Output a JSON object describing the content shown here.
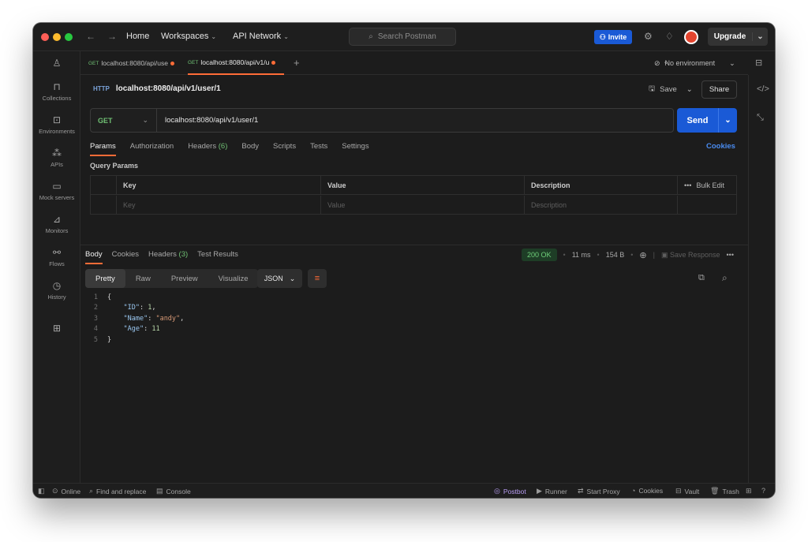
{
  "topbar": {
    "home": "Home",
    "workspaces": "Workspaces",
    "api_network": "API Network",
    "search_placeholder": "Search Postman",
    "invite": "Invite",
    "upgrade": "Upgrade"
  },
  "sidebar": {
    "items": [
      {
        "label": "Collections",
        "icon": "collections-icon"
      },
      {
        "label": "Environments",
        "icon": "environments-icon"
      },
      {
        "label": "APIs",
        "icon": "apis-icon"
      },
      {
        "label": "Mock servers",
        "icon": "mock-servers-icon"
      },
      {
        "label": "Monitors",
        "icon": "monitors-icon"
      },
      {
        "label": "Flows",
        "icon": "flows-icon"
      },
      {
        "label": "History",
        "icon": "history-icon"
      }
    ]
  },
  "tabs": [
    {
      "method": "GET",
      "label": "localhost:8080/api/use"
    },
    {
      "method": "GET",
      "label": "localhost:8080/api/v1/u"
    }
  ],
  "environment": "No environment",
  "request": {
    "title": "localhost:8080/api/v1/user/1",
    "http_badge": "HTTP",
    "save": "Save",
    "share": "Share",
    "method": "GET",
    "url": "localhost:8080/api/v1/user/1",
    "send": "Send",
    "tabs": {
      "params": "Params",
      "authorization": "Authorization",
      "headers": "Headers",
      "headers_count": "(6)",
      "body": "Body",
      "scripts": "Scripts",
      "tests": "Tests",
      "settings": "Settings"
    },
    "cookies": "Cookies",
    "query_params_title": "Query Params",
    "params_table": {
      "headers": [
        "Key",
        "Value",
        "Description"
      ],
      "bulk_edit": "Bulk Edit",
      "placeholders": [
        "Key",
        "Value",
        "Description"
      ]
    }
  },
  "response": {
    "tabs": {
      "body": "Body",
      "cookies": "Cookies",
      "headers": "Headers",
      "headers_count": "(3)",
      "test_results": "Test Results"
    },
    "status": "200 OK",
    "time": "11 ms",
    "size": "154 B",
    "save_response": "Save Response",
    "format_tabs": [
      "Pretty",
      "Raw",
      "Preview",
      "Visualize"
    ],
    "format": "JSON",
    "lines": [
      {
        "n": "1",
        "text": "{"
      },
      {
        "n": "2",
        "key": "\"ID\"",
        "value": "1",
        "value_type": "number",
        "trail": ","
      },
      {
        "n": "3",
        "key": "\"Name\"",
        "value": "\"andy\"",
        "value_type": "string",
        "trail": ","
      },
      {
        "n": "4",
        "key": "\"Age\"",
        "value": "11",
        "value_type": "number",
        "trail": ""
      },
      {
        "n": "5",
        "text": "}"
      }
    ]
  },
  "statusbar": {
    "online": "Online",
    "find_replace": "Find and replace",
    "console": "Console",
    "postbot": "Postbot",
    "runner": "Runner",
    "start_proxy": "Start Proxy",
    "cookies": "Cookies",
    "vault": "Vault",
    "trash": "Trash"
  }
}
